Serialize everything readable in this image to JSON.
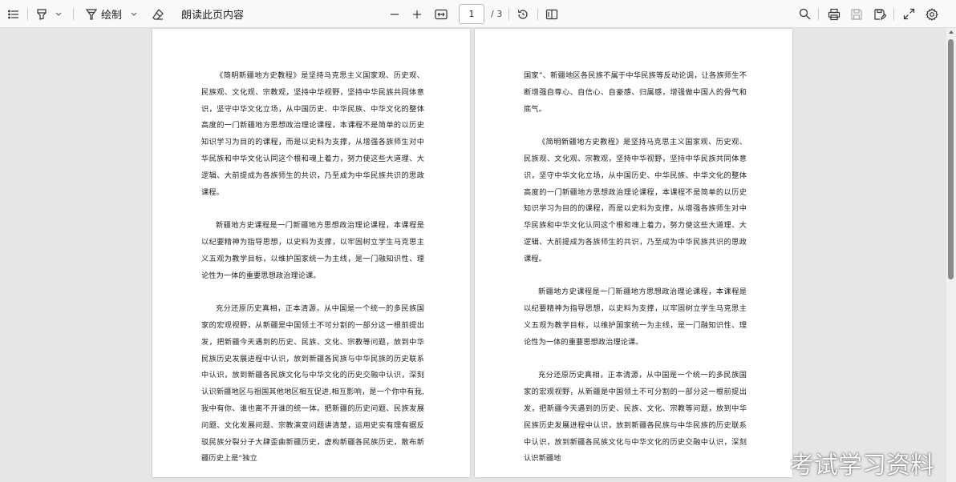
{
  "toolbar": {
    "draw_label": "绘制",
    "read_aloud_label": "朗读此页内容",
    "page_number": "1",
    "page_total": "/ 3",
    "icons": [
      "contents-icon",
      "highlight-icon",
      "draw-icon",
      "eraser-icon",
      "zoom-out-icon",
      "zoom-in-icon",
      "fit-width-icon",
      "rotate-icon",
      "two-page-icon",
      "search-icon",
      "print-icon",
      "save-icon",
      "save-as-icon",
      "fullscreen-icon",
      "settings-icon"
    ]
  },
  "pages": [
    {
      "paragraphs": [
        {
          "text": "《简明新疆地方史教程》是坚持马克思主义国家观、历史观、民族观、文化观、宗教观，坚持中华视野，坚持中华民族共同体意识，坚守中华文化立场，从中国历史、中华民族、中华文化的整体高度的一门新疆地方思想政治理论课程，本课程不是简单的以历史知识学习为目的的课程，而是以史料为支撑，从增强各族师生对中华民族和中华文化认同这个根和魂上着力，努力使这些大道理、大逻辑、大前提成为各族师生的共识，乃至成为中华民族共识的思政课程。",
          "indent": true
        },
        {
          "text": "新疆地方史课程是一门新疆地方思想政治理论课程，本课程是以纪要精神为指导思想，以史料为支撑，以牢固树立学生马克思主义五观为教学目标，以维护国家统一为主线，是一门融知识性、理论性为一体的重要思想政治理论课。",
          "indent": true
        },
        {
          "text": "充分还原历史真相，正本清源，从中国是一个统一的多民族国家的宏观视野，从新疆是中国领土不可分割的一部分这一根前提出发，把新疆今天遇到的历史、民族、文化、宗教等问题，放到中华民族历史发展进程中认识，放到新疆各民族与中华民族的历史联系中认识，放到新疆各民族文化与中华文化的历史交融中认识，深刻认识新疆地区与祖国其他地区相互促进,相互影响，是一个你中有我,我中有你、谁也离不开谁的统一体。把新疆的历史问题、民族发展问题、文化发展问题、宗教演变问题讲清楚，运用史实有理有据反驳民族分裂分子大肆歪曲新疆历史，虚构新疆各民族历史，散布新疆历史上是“独立",
          "indent": true
        }
      ]
    },
    {
      "paragraphs": [
        {
          "text": "国家”、新疆地区各民族不属于中华民族等反动论调，让各族师生不断增强自尊心、自信心、自豪感、归属感，增强做中国人的骨气和底气。",
          "indent": false
        },
        {
          "text": "《简明新疆地方史教程》是坚持马克思主义国家观、历史观、民族观、文化观、宗教观，坚持中华视野，坚持中华民族共同体意识，坚守中华文化立场，从中国历史、中华民族、中华文化的整体高度的一门新疆地方思想政治理论课程，本课程不是简单的以历史知识学习为目的的课程，而是以史料为支撑，从增强各族师生对中华民族和中华文化认同这个根和魂上着力，努力使这些大道理、大逻辑、大前提成为各族师生的共识，乃至成为中华民族共识的思政课程。",
          "indent": true
        },
        {
          "text": "新疆地方史课程是一门新疆地方思想政治理论课程，本课程是以纪要精神为指导思想，以史料为支撑，以牢固树立学生马克思主义五观为教学目标，以维护国家统一为主线，是一门融知识性、理论性为一体的重要思想政治理论课。",
          "indent": true
        },
        {
          "text": "充分还原历史真相，正本清源，从中国是一个统一的多民族国家的宏观视野，从新疆是中国领土不可分割的一部分这一根前提出发，把新疆今天遇到的历史、民族、文化、宗教等问题，放到中华民族历史发展进程中认识，放到新疆各民族与中华民族的历史联系中认识，放到新疆各民族文化与中华文化的历史交融中认识，深刻认识新疆地",
          "indent": true
        }
      ]
    }
  ],
  "watermark": "考试学习资料"
}
